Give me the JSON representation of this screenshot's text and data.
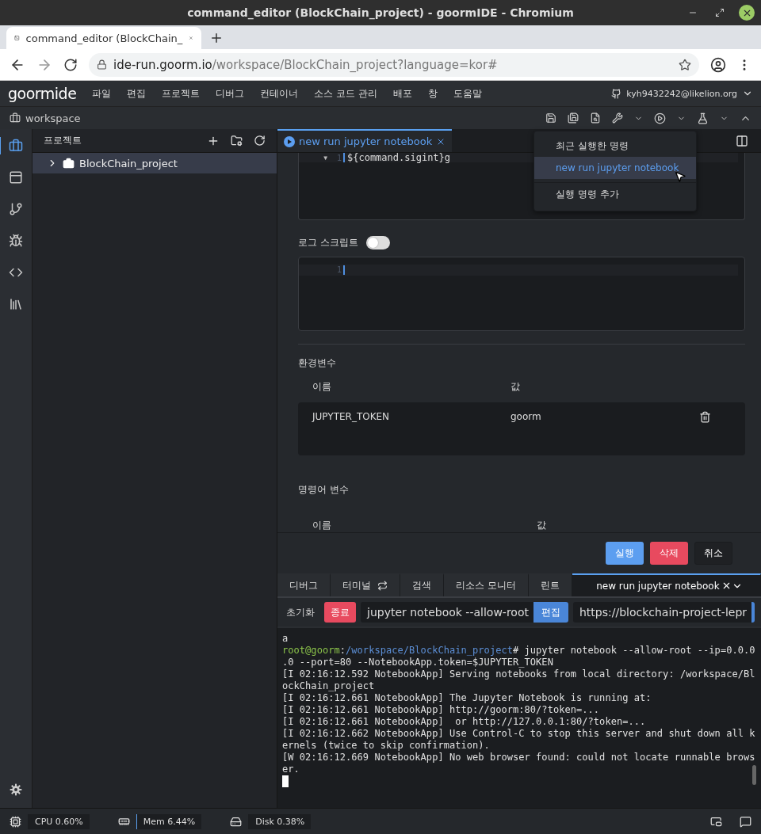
{
  "window": {
    "title": "command_editor (BlockChain_project) - goormIDE - Chromium"
  },
  "browser": {
    "tab": "command_editor (BlockChain_",
    "url_host": "ide-run.goorm.io",
    "url_path": "/workspace/BlockChain_project?language=kor#"
  },
  "menu_bar": {
    "logo": "goormide",
    "items": [
      "파일",
      "편집",
      "프로젝트",
      "디버그",
      "컨테이너",
      "소스 코드 관리",
      "배포",
      "창",
      "도움말"
    ],
    "user": "kyh9432242@likelion.org"
  },
  "workspace_bar": {
    "label": "workspace"
  },
  "activity_bar": [
    {
      "selected": true
    },
    {
      "selected": false
    },
    {
      "selected": false
    },
    {
      "selected": false
    },
    {
      "selected": false
    },
    {
      "selected": false
    }
  ],
  "project_panel": {
    "title": "프로젝트",
    "tree": [
      {
        "label": "BlockChain_project",
        "expanded": false,
        "selected": true
      }
    ]
  },
  "editor_tab": {
    "label": "new run jupyter notebook"
  },
  "command_editor": {
    "fold_marker": "▼",
    "line_number": "1",
    "code": "${command.sigint}g"
  },
  "dropdown": [
    {
      "label": "최근 실행한 명령",
      "kind": "header",
      "selected": false
    },
    {
      "label": "new run jupyter notebook",
      "kind": "command",
      "selected": true
    },
    {
      "label": "실행 명령 추가",
      "kind": "action",
      "selected": false
    }
  ],
  "log_script": {
    "label": "로그 스크립트",
    "on": false,
    "line_number": "1"
  },
  "env_vars": {
    "title": "환경변수",
    "columns": [
      "이름",
      "값"
    ],
    "rows": [
      {
        "name": "JUPYTER_TOKEN",
        "value": "goorm"
      }
    ]
  },
  "command_vars": {
    "title": "명령어 변수",
    "columns": [
      "이름",
      "값"
    ]
  },
  "buttons": [
    {
      "label": "실행",
      "kind": "primary"
    },
    {
      "label": "삭제",
      "kind": "danger"
    },
    {
      "label": "취소",
      "kind": "default"
    }
  ],
  "bottom_tabs": [
    {
      "label": "디버그",
      "kind": "plain",
      "selected": false
    },
    {
      "label": "터미널",
      "kind": "terminal",
      "selected": false
    },
    {
      "label": "검색",
      "kind": "plain",
      "selected": false
    },
    {
      "label": "리소스 모니터",
      "kind": "plain",
      "selected": false
    },
    {
      "label": "린트",
      "kind": "plain",
      "selected": false
    },
    {
      "label": "new run jupyter notebook",
      "kind": "run",
      "selected": true
    }
  ],
  "run_toolbar": {
    "reset": "초기화",
    "stop": "종료",
    "command": "jupyter notebook --allow-root",
    "edit": "편집",
    "url": "https://blockchain-project-lepr"
  },
  "terminal": [
    {
      "kind": "plain",
      "text": "a"
    },
    {
      "kind": "prompt",
      "user": "root@goorm",
      "separator": ":",
      "path": "/workspace/BlockChain_project",
      "text": "# jupyter notebook --allow-root --ip=0.0.0"
    },
    {
      "kind": "plain",
      "text": ".0 --port=80 --NotebookApp.token=$JUPYTER_TOKEN"
    },
    {
      "kind": "plain",
      "text": "[I 02:16:12.592 NotebookApp] Serving notebooks from local directory: /workspace/Bl"
    },
    {
      "kind": "plain",
      "text": "ockChain_project"
    },
    {
      "kind": "plain",
      "text": "[I 02:16:12.661 NotebookApp] The Jupyter Notebook is running at:"
    },
    {
      "kind": "plain",
      "text": "[I 02:16:12.661 NotebookApp] http://goorm:80/?token=..."
    },
    {
      "kind": "plain",
      "text": "[I 02:16:12.661 NotebookApp]  or http://127.0.0.1:80/?token=..."
    },
    {
      "kind": "plain",
      "text": "[I 02:16:12.662 NotebookApp] Use Control-C to stop this server and shut down all k"
    },
    {
      "kind": "plain",
      "text": "ernels (twice to skip confirmation)."
    },
    {
      "kind": "plain",
      "text": "[W 02:16:12.669 NotebookApp] No web browser found: could not locate runnable brows"
    },
    {
      "kind": "plain",
      "text": "er."
    },
    {
      "kind": "cursor"
    }
  ],
  "status_bar": [
    {
      "kind": "cpu",
      "text": "CPU 0.60%"
    },
    {
      "kind": "mem",
      "text": "Mem 6.44%"
    },
    {
      "kind": "disk",
      "text": "Disk 0.38%"
    }
  ]
}
